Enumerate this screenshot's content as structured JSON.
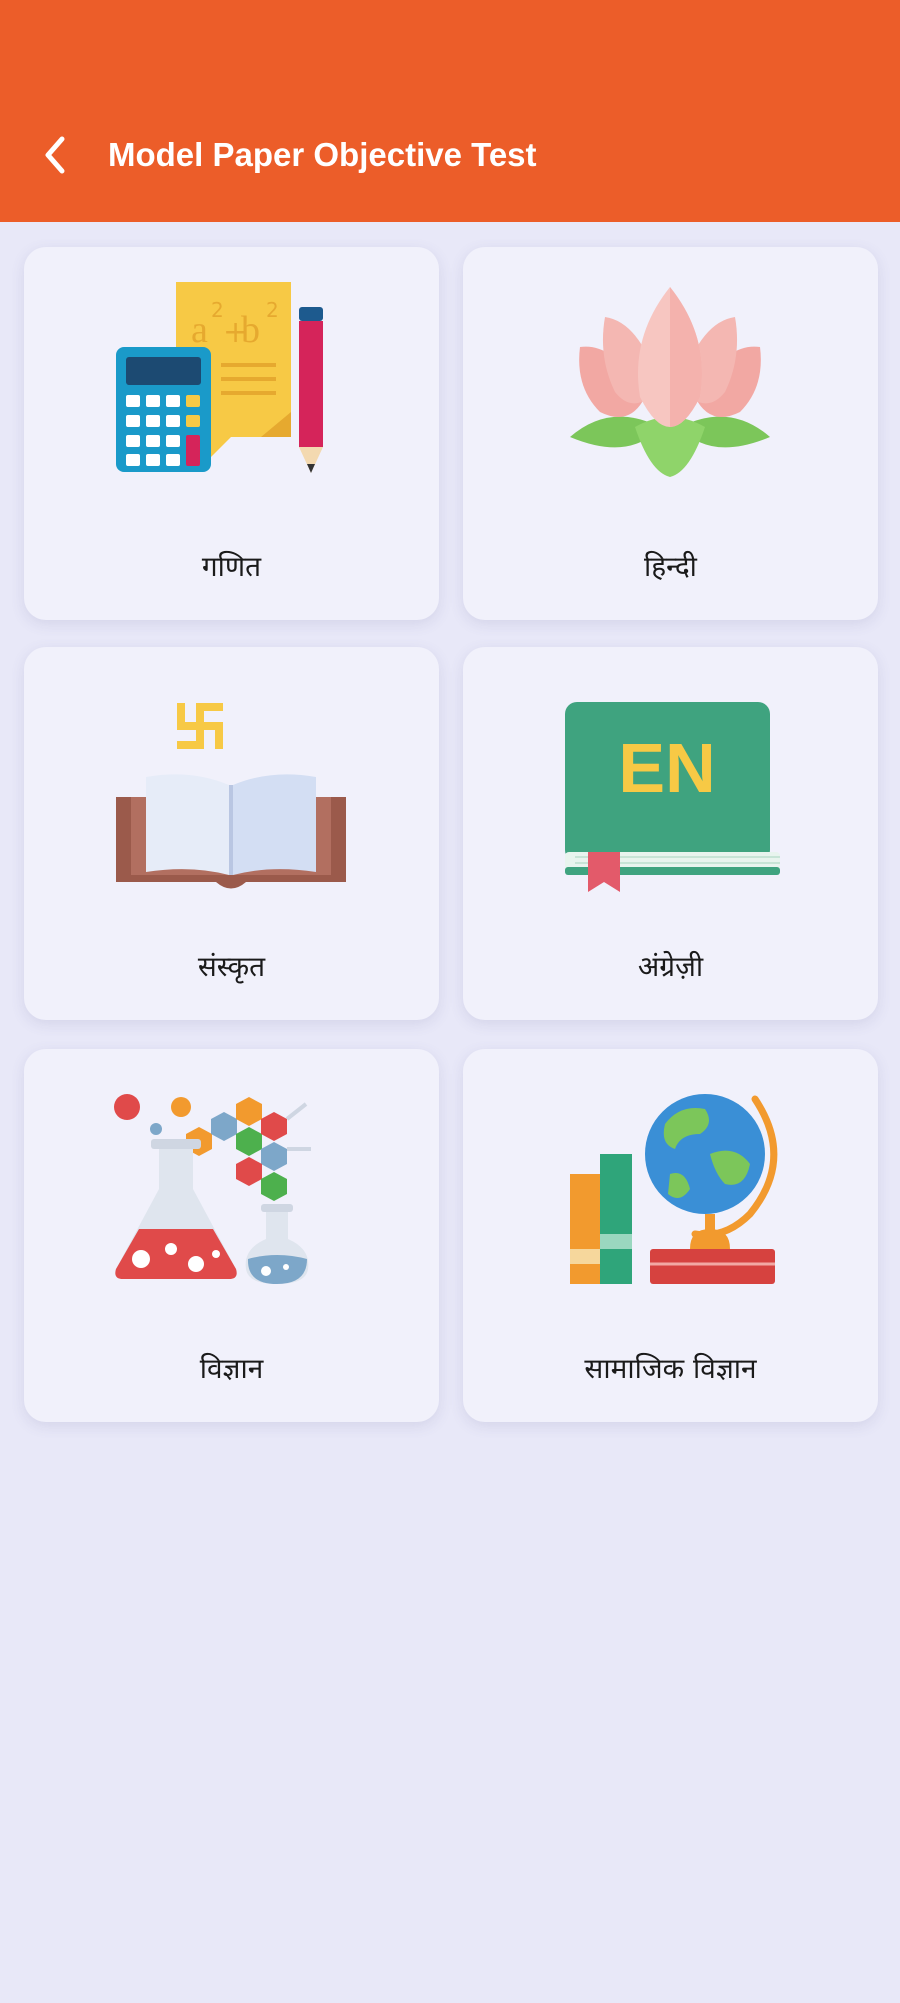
{
  "header": {
    "title": "Model Paper Objective Test",
    "back_icon": "back-arrow-icon",
    "color": "#ec5d29"
  },
  "subjects": [
    {
      "label": "गणित",
      "icon": "math-calculator-icon"
    },
    {
      "label": "हिन्दी",
      "icon": "lotus-icon"
    },
    {
      "label": "संस्कृत",
      "icon": "open-book-swastika-icon"
    },
    {
      "label": "अंग्रेज़ी",
      "icon": "english-book-icon",
      "badge_text": "EN"
    },
    {
      "label": "विज्ञान",
      "icon": "science-flask-icon"
    },
    {
      "label": "सामाजिक विज्ञान",
      "icon": "globe-books-icon"
    }
  ]
}
